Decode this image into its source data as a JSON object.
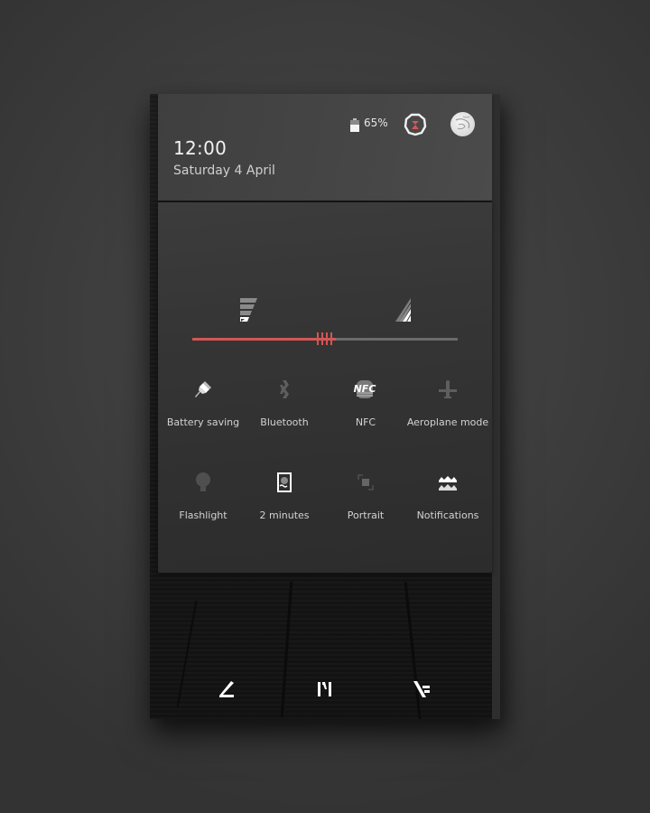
{
  "status": {
    "time": "12:00",
    "date": "Saturday 4 April",
    "battery_percent": "65%",
    "battery_level": 0.65
  },
  "header_actions": {
    "settings_icon": "settings-gear-icon",
    "avatar_icon": "user-avatar"
  },
  "brightness": {
    "level": 0.5,
    "fill_color": "#d45656",
    "track_color": "#6b6b6b"
  },
  "signals": [
    {
      "name": "wifi-signal-icon",
      "strength": 1,
      "of": 4
    },
    {
      "name": "cellular-signal-icon",
      "strength": 2,
      "of": 4
    }
  ],
  "tiles": [
    {
      "label": "Battery saving",
      "icon": "pin-icon",
      "active": true
    },
    {
      "label": "Bluetooth",
      "icon": "bluetooth-icon",
      "active": false
    },
    {
      "label": "NFC",
      "icon": "nfc-icon",
      "active": true
    },
    {
      "label": "Aeroplane mode",
      "icon": "airplane-icon",
      "active": false
    },
    {
      "label": "Flashlight",
      "icon": "flashlight-icon",
      "active": false
    },
    {
      "label": "2 minutes",
      "icon": "screen-timeout-icon",
      "active": true
    },
    {
      "label": "Portrait",
      "icon": "rotation-icon",
      "active": false
    },
    {
      "label": "Notifications",
      "icon": "notifications-icon",
      "active": true
    }
  ],
  "navigation": {
    "back": "back-icon",
    "home": "home-icon",
    "recents": "recents-icon"
  },
  "colors": {
    "accent": "#d45656",
    "active_icon": "#ffffff",
    "inactive_icon": "#5e5e5e",
    "label": "#d2d2d2"
  }
}
